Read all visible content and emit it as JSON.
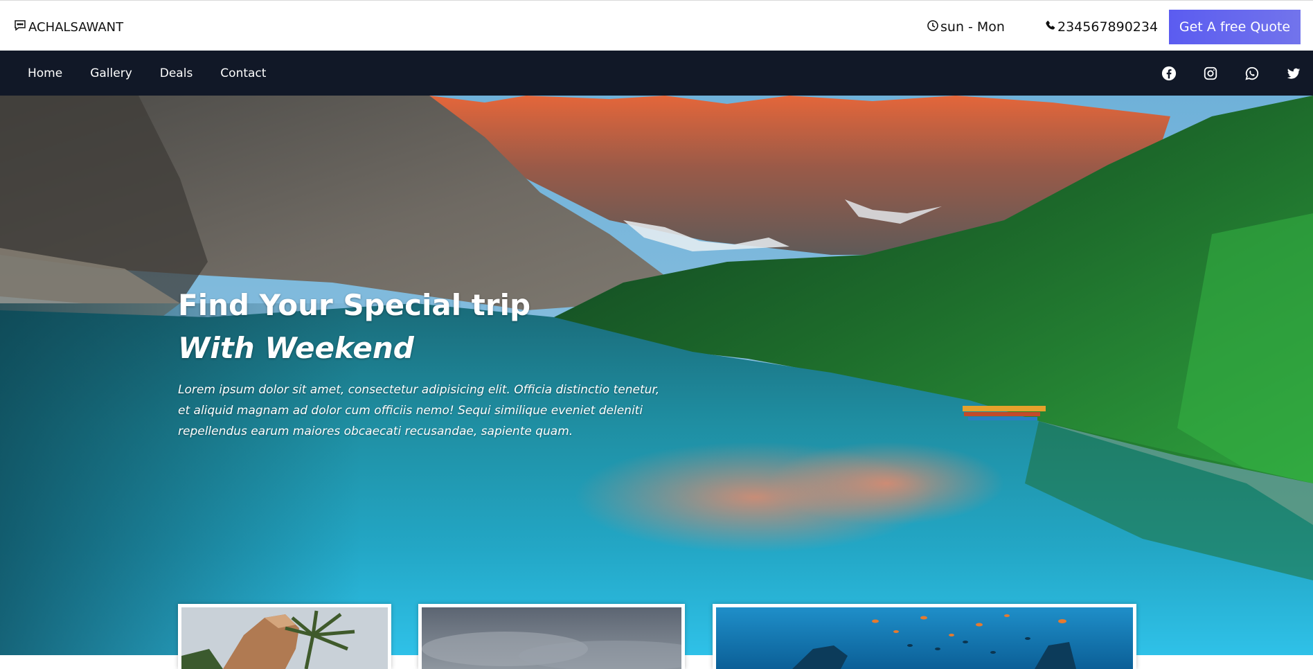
{
  "header": {
    "brand": "ACHALSAWANT",
    "hours": "sun - Mon",
    "phone": "234567890234",
    "quote_button": "Get A free Quote"
  },
  "nav": {
    "links": [
      "Home",
      "Gallery",
      "Deals",
      "Contact"
    ],
    "socials": [
      "facebook-icon",
      "instagram-icon",
      "whatsapp-icon",
      "twitter-icon"
    ]
  },
  "hero": {
    "title_line1": "Find Your Special trip",
    "title_line2": "With Weekend",
    "description": "Lorem ipsum dolor sit amet, consectetur adipisicing elit. Officia distinctio tenetur, et aliquid magnam ad dolor cum officiis nemo! Sequi similique eveniet deleniti repellendus earum maiores obcaecati recusandae, sapiente quam."
  },
  "colors": {
    "nav_bg": "#111827",
    "accent": "#5b5cf0"
  }
}
